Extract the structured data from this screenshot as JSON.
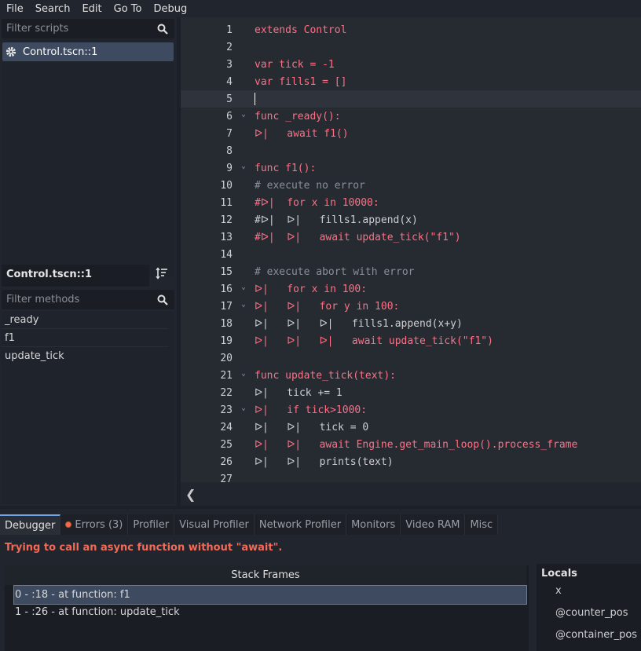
{
  "menu": [
    "File",
    "Search",
    "Edit",
    "Go To",
    "Debug"
  ],
  "scripts_panel": {
    "filter_placeholder": "Filter scripts",
    "items": [
      "Control.tscn::1"
    ]
  },
  "methods_panel": {
    "current_script": "Control.tscn::1",
    "filter_placeholder": "Filter methods",
    "methods": [
      "_ready",
      "f1",
      "update_tick"
    ]
  },
  "editor": {
    "lines": [
      {
        "n": "1",
        "text": "extends Control"
      },
      {
        "n": "2",
        "text": ""
      },
      {
        "n": "3",
        "text": "var tick = -1"
      },
      {
        "n": "4",
        "text": "var fills1 = []"
      },
      {
        "n": "5",
        "text": ""
      },
      {
        "n": "6",
        "text": "func _ready():"
      },
      {
        "n": "7",
        "text": "ᐅ|   await f1()"
      },
      {
        "n": "8",
        "text": ""
      },
      {
        "n": "9",
        "text": "func f1():"
      },
      {
        "n": "10",
        "text": "# execute no error"
      },
      {
        "n": "11",
        "text": "#ᐅ|  for x in 10000:"
      },
      {
        "n": "12",
        "text": "#ᐅ|  ᐅ|   fills1.append(x)"
      },
      {
        "n": "13",
        "text": "#ᐅ|  ᐅ|   await update_tick(\"f1\")"
      },
      {
        "n": "14",
        "text": ""
      },
      {
        "n": "15",
        "text": "# execute abort with error"
      },
      {
        "n": "16",
        "text": "ᐅ|   for x in 100:"
      },
      {
        "n": "17",
        "text": "ᐅ|   ᐅ|   for y in 100:"
      },
      {
        "n": "18",
        "text": "ᐅ|   ᐅ|   ᐅ|   fills1.append(x+y)"
      },
      {
        "n": "19",
        "text": "ᐅ|   ᐅ|   ᐅ|   await update_tick(\"f1\")"
      },
      {
        "n": "20",
        "text": ""
      },
      {
        "n": "21",
        "text": "func update_tick(text):"
      },
      {
        "n": "22",
        "text": "ᐅ|   tick += 1"
      },
      {
        "n": "23",
        "text": "ᐅ|   if tick>1000:"
      },
      {
        "n": "24",
        "text": "ᐅ|   ᐅ|   tick = 0"
      },
      {
        "n": "25",
        "text": "ᐅ|   ᐅ|   await Engine.get_main_loop().process_frame"
      },
      {
        "n": "26",
        "text": "ᐅ|   ᐅ|   prints(text)"
      },
      {
        "n": "27",
        "text": ""
      }
    ]
  },
  "bottom": {
    "tabs": [
      "Debugger",
      "Errors (3)",
      "Profiler",
      "Visual Profiler",
      "Network Profiler",
      "Monitors",
      "Video RAM",
      "Misc"
    ],
    "error_message": "Trying to call an async function without \"await\".",
    "stack_header": "Stack Frames",
    "frames": [
      "0 - :18 - at function: f1",
      "1 - :26 - at function: update_tick"
    ],
    "locals_title": "Locals",
    "locals": [
      "x",
      "@counter_pos",
      "@container_pos"
    ]
  },
  "colors": {
    "accent": "#6da5e8",
    "keyword": "#ff7085",
    "error": "#f26a58",
    "selection": "#3e4a5f"
  }
}
